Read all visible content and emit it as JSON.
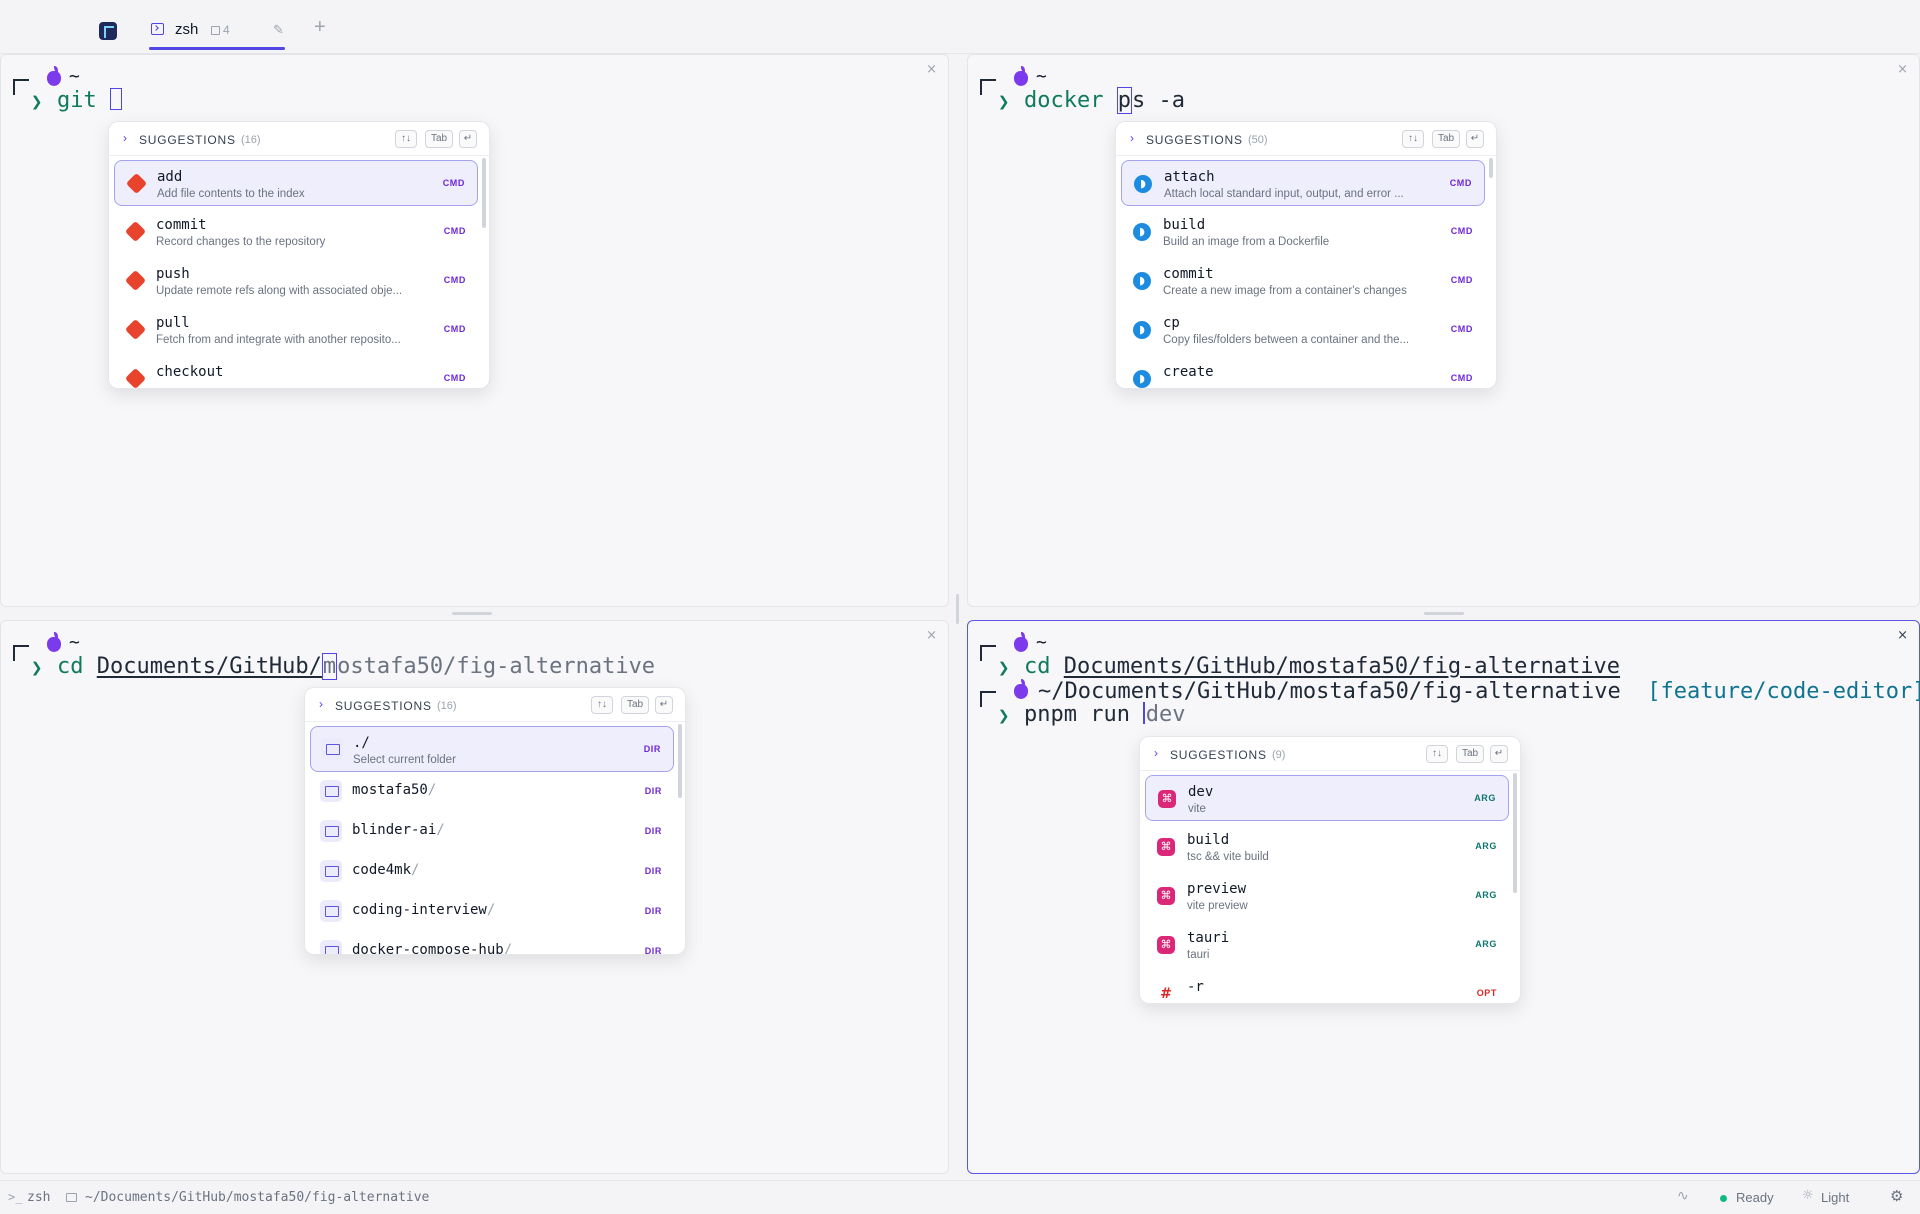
{
  "tabbar": {
    "tab_title": "zsh",
    "tab_pane_count": "4",
    "new_tab": "+",
    "edit_glyph": "✎"
  },
  "panes": {
    "close_glyph": "×",
    "p1": {
      "cwd": "~",
      "cmd": "git",
      "popup": {
        "title": "SUGGESTIONS",
        "count": "(16)",
        "keys": [
          "↑↓",
          "Tab",
          "↵"
        ],
        "items": [
          {
            "name": "add",
            "desc": "Add file contents to the index",
            "badge": "CMD"
          },
          {
            "name": "commit",
            "desc": "Record changes to the repository",
            "badge": "CMD"
          },
          {
            "name": "push",
            "desc": "Update remote refs along with associated obje...",
            "badge": "CMD"
          },
          {
            "name": "pull",
            "desc": "Fetch from and integrate with another reposito...",
            "badge": "CMD"
          },
          {
            "name": "checkout",
            "desc": "",
            "badge": "CMD"
          }
        ]
      }
    },
    "p2": {
      "cwd": "~",
      "cmd_pre": "docker",
      "cmd_box": "p",
      "cmd_rest": "s -a",
      "popup": {
        "title": "SUGGESTIONS",
        "count": "(50)",
        "keys": [
          "↑↓",
          "Tab",
          "↵"
        ],
        "items": [
          {
            "name": "attach",
            "desc": "Attach local standard input, output, and error ...",
            "badge": "CMD"
          },
          {
            "name": "build",
            "desc": "Build an image from a Dockerfile",
            "badge": "CMD"
          },
          {
            "name": "commit",
            "desc": "Create a new image from a container's changes",
            "badge": "CMD"
          },
          {
            "name": "cp",
            "desc": "Copy files/folders between a container and the...",
            "badge": "CMD"
          },
          {
            "name": "create",
            "desc": "",
            "badge": "CMD"
          }
        ]
      }
    },
    "p3": {
      "cwd": "~",
      "cmd_pre": "cd",
      "cmd_path_typed": "Documents/GitHub/",
      "cmd_cursor_char": "m",
      "cmd_ghost": "ostafa50/fig-alternative",
      "popup": {
        "title": "SUGGESTIONS",
        "count": "(16)",
        "keys": [
          "↑↓",
          "Tab",
          "↵"
        ],
        "items": [
          {
            "name": "./",
            "desc": "Select current folder",
            "badge": "DIR"
          },
          {
            "name": "mostafa50",
            "slash": "/",
            "badge": "DIR"
          },
          {
            "name": "blinder-ai",
            "slash": "/",
            "badge": "DIR"
          },
          {
            "name": "code4mk",
            "slash": "/",
            "badge": "DIR"
          },
          {
            "name": "coding-interview",
            "slash": "/",
            "badge": "DIR"
          },
          {
            "name": "docker-compose-hub",
            "slash": "/",
            "badge": "DIR"
          }
        ]
      }
    },
    "p4": {
      "cwd": "~",
      "line1_cmd": "cd",
      "line1_path": "Documents/GitHub/mostafa50/fig-alternative",
      "line2_path": "~/Documents/GitHub/mostafa50/fig-alternative",
      "line2_branch": "[feature/code-editor]",
      "line3_cmd": "pnpm run",
      "line3_ghost": "dev",
      "popup": {
        "title": "SUGGESTIONS",
        "count": "(9)",
        "keys": [
          "↑↓",
          "Tab",
          "↵"
        ],
        "items": [
          {
            "name": "dev",
            "desc": "vite",
            "badge": "ARG"
          },
          {
            "name": "build",
            "desc": "tsc && vite build",
            "badge": "ARG"
          },
          {
            "name": "preview",
            "desc": "vite preview",
            "badge": "ARG"
          },
          {
            "name": "tauri",
            "desc": "tauri",
            "badge": "ARG"
          },
          {
            "name": "-r",
            "desc": "",
            "badge": "OPT"
          }
        ]
      }
    }
  },
  "statusbar": {
    "shell_icon": ">_",
    "shell": "zsh",
    "path": "~/Documents/GitHub/mostafa50/fig-alternative",
    "activity_icon": "∿",
    "status": "Ready",
    "theme_icon": "☼",
    "theme": "Light",
    "settings_icon": "⚙"
  },
  "colors": {
    "accent": "#4f46e5",
    "prompt_green": "#0f7a5c",
    "git_red": "#e8432d",
    "docker_blue": "#1d8ce0",
    "pnpm_pink": "#db2777",
    "ready_green": "#10b981"
  },
  "icons": {
    "app": "app-logo-icon",
    "git": "git-icon",
    "docker": "docker-whale-icon",
    "pnpm": "command-icon",
    "dir": "folder-icon",
    "opt": "hash-icon",
    "apple": "apple-icon"
  }
}
